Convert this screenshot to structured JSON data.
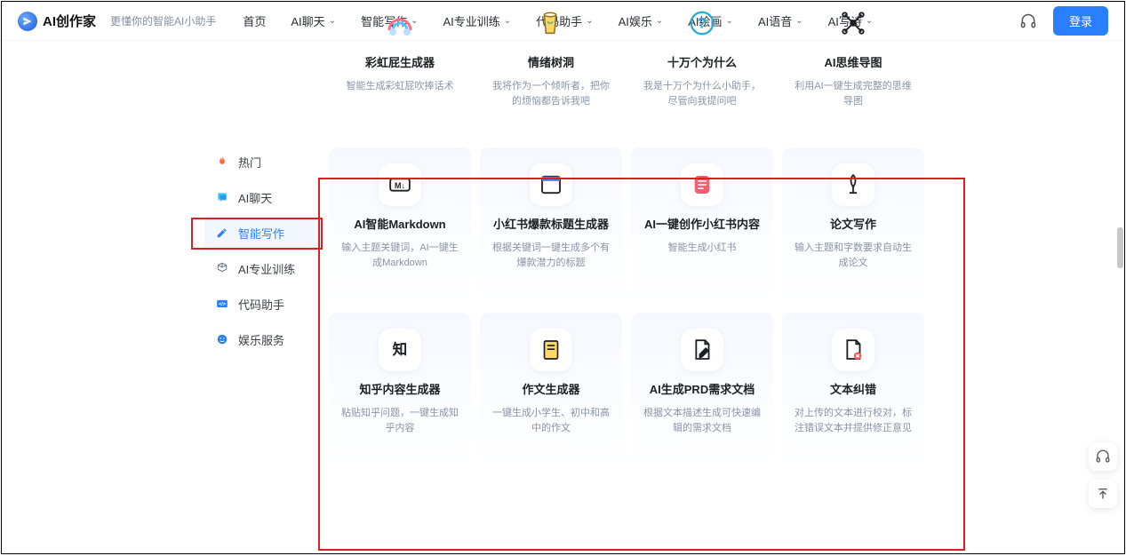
{
  "header": {
    "brand": "AI创作家",
    "tagline": "更懂你的智能AI小助手",
    "login": "登录",
    "nav": [
      {
        "label": "首页"
      },
      {
        "label": "AI聊天"
      },
      {
        "label": "智能写作"
      },
      {
        "label": "AI专业训练"
      },
      {
        "label": "代码助手"
      },
      {
        "label": "AI娱乐"
      },
      {
        "label": "AI绘画"
      },
      {
        "label": "AI语音"
      },
      {
        "label": "AI写诗"
      }
    ]
  },
  "sidebar": [
    {
      "label": "热门",
      "icon": "fire-icon"
    },
    {
      "label": "AI聊天",
      "icon": "chat-icon"
    },
    {
      "label": "智能写作",
      "icon": "edit-icon",
      "active": true
    },
    {
      "label": "AI专业训练",
      "icon": "cube-icon"
    },
    {
      "label": "代码助手",
      "icon": "code-icon"
    },
    {
      "label": "娱乐服务",
      "icon": "smile-icon"
    }
  ],
  "cards": [
    {
      "title": "彩虹屁生成器",
      "desc": "智能生成彩虹屁吹捧话术"
    },
    {
      "title": "情绪树洞",
      "desc": "我将作为一个倾听者，把你的烦恼都告诉我吧"
    },
    {
      "title": "十万个为什么",
      "desc": "我是十万个为什么小助手，尽管向我提问吧"
    },
    {
      "title": "AI思维导图",
      "desc": "利用AI一键生成完整的思维导图"
    },
    {
      "title": "AI智能Markdown",
      "desc": "输入主题关键词，AI一键生成Markdown"
    },
    {
      "title": "小红书爆款标题生成器",
      "desc": "根据关键词一键生成多个有爆款潜力的标题"
    },
    {
      "title": "AI一键创作小红书内容",
      "desc": "智能生成小红书"
    },
    {
      "title": "论文写作",
      "desc": "输入主题和字数要求自动生成论文"
    },
    {
      "title": "知乎内容生成器",
      "desc": "粘贴知乎问题，一键生成知乎内容"
    },
    {
      "title": "作文生成器",
      "desc": "一键生成小学生、初中和高中的作文"
    },
    {
      "title": "AI生成PRD需求文档",
      "desc": "根据文本描述生成可快速编辑的需求文档"
    },
    {
      "title": "文本纠错",
      "desc": "对上传的文本进行校对，标注错误文本并提供修正意见"
    }
  ]
}
